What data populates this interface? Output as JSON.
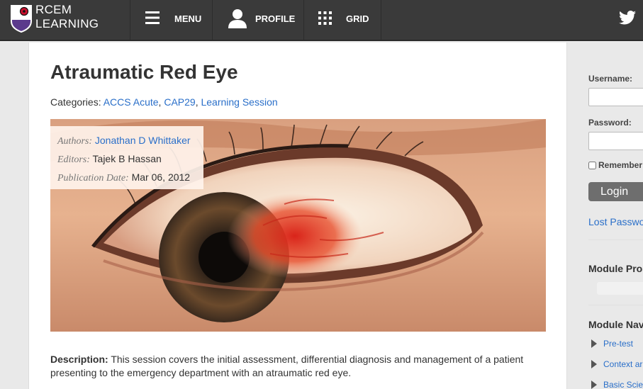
{
  "header": {
    "brand_line1": "RCEM",
    "brand_line2": "LEARNING",
    "menu_label": "MENU",
    "profile_label": "PROFILE",
    "grid_label": "GRID",
    "icons": [
      "shield-logo",
      "hamburger-icon",
      "user-icon",
      "grid-icon",
      "twitter-icon"
    ]
  },
  "article": {
    "title": "Atraumatic Red Eye",
    "categories_label": "Categories:",
    "categories": [
      "ACCS Acute",
      "CAP29",
      "Learning Session"
    ],
    "authors_label": "Authors:",
    "authors": "Jonathan D Whittaker",
    "editors_label": "Editors:",
    "editors": "Tajek B Hassan",
    "pubdate_label": "Publication Date:",
    "pubdate": "Mar 06, 2012",
    "description_label": "Description:",
    "description": " This session covers the initial assessment, differential diagnosis and management of a patient presenting to the emergency department with an atraumatic red eye."
  },
  "sidebar": {
    "username_label": "Username:",
    "password_label": "Password:",
    "remember_label": "Remember",
    "login_label": "Login",
    "lost_password": "Lost Passwo",
    "module_progress": "Module Pro",
    "module_nav": "Module Nav",
    "nav_items": [
      "Pre-test",
      "Context ar",
      "Basic Scie"
    ]
  },
  "colors": {
    "topbar": "#3a3a3a",
    "link": "#2a6fc9",
    "login_button": "#6e6e6e"
  }
}
